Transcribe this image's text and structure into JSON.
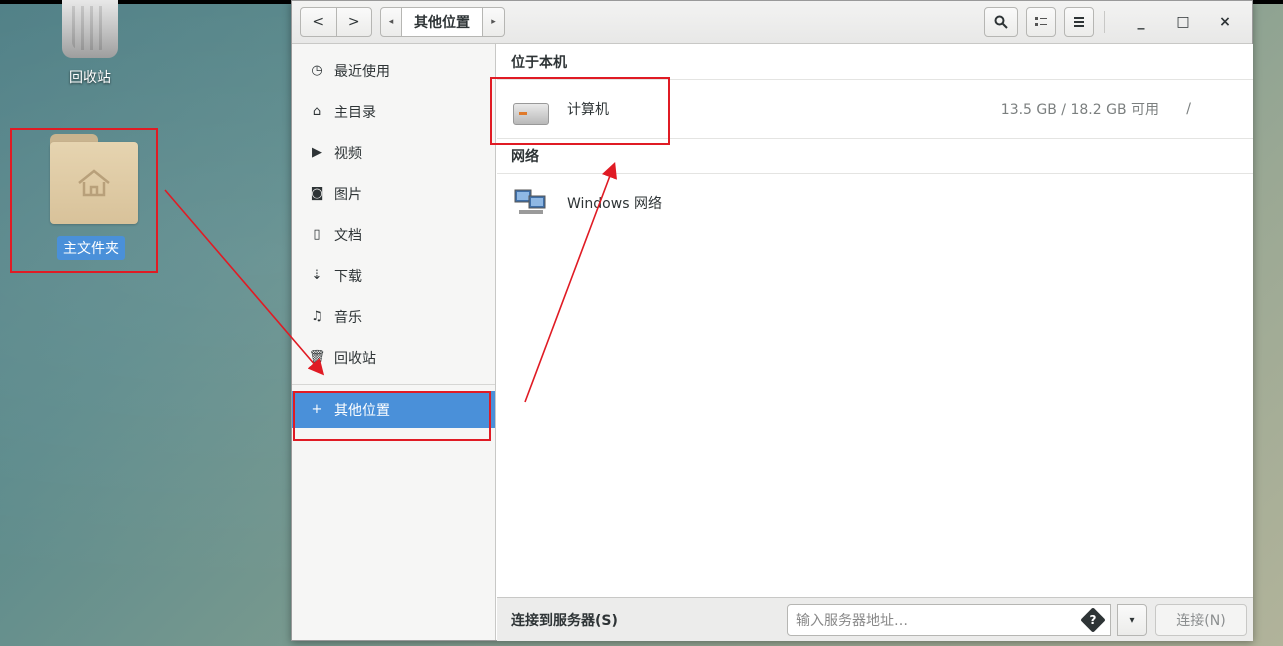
{
  "desktop": {
    "trash_label": "回收站",
    "home_label": "主文件夹"
  },
  "headerbar": {
    "back": "<",
    "forward": ">",
    "path_left": "◂",
    "path_current": "其他位置",
    "path_right": "▸",
    "search_icon": "search-icon",
    "view_icon": "list-view-icon",
    "menu_icon": "hamburger-menu-icon",
    "minimize": "_",
    "maximize": "□",
    "close": "×"
  },
  "sidebar": {
    "items": [
      {
        "icon": "◷",
        "label": "最近使用"
      },
      {
        "icon": "⌂",
        "label": "主目录"
      },
      {
        "icon": "▶",
        "label": "视频"
      },
      {
        "icon": "◙",
        "label": "图片"
      },
      {
        "icon": "▯",
        "label": "文档"
      },
      {
        "icon": "⇣",
        "label": "下载"
      },
      {
        "icon": "♫",
        "label": "音乐"
      },
      {
        "icon": "🗑",
        "label": "回收站"
      }
    ],
    "other_locations": {
      "icon": "+",
      "label": "其他位置"
    }
  },
  "main": {
    "local_section": "位于本机",
    "computer": {
      "name": "计算机",
      "space": "13.5 GB / 18.2 GB 可用",
      "mount": "/"
    },
    "network_section": "网络",
    "windows_network": {
      "name": "Windows 网络"
    }
  },
  "bottom": {
    "connect_label": "连接到服务器(S)",
    "server_placeholder": "输入服务器地址…",
    "help_glyph": "?",
    "dropdown_glyph": "▾",
    "connect_button": "连接(N)"
  },
  "colors": {
    "accent": "#4a90d9",
    "annotation": "#e01b24"
  }
}
